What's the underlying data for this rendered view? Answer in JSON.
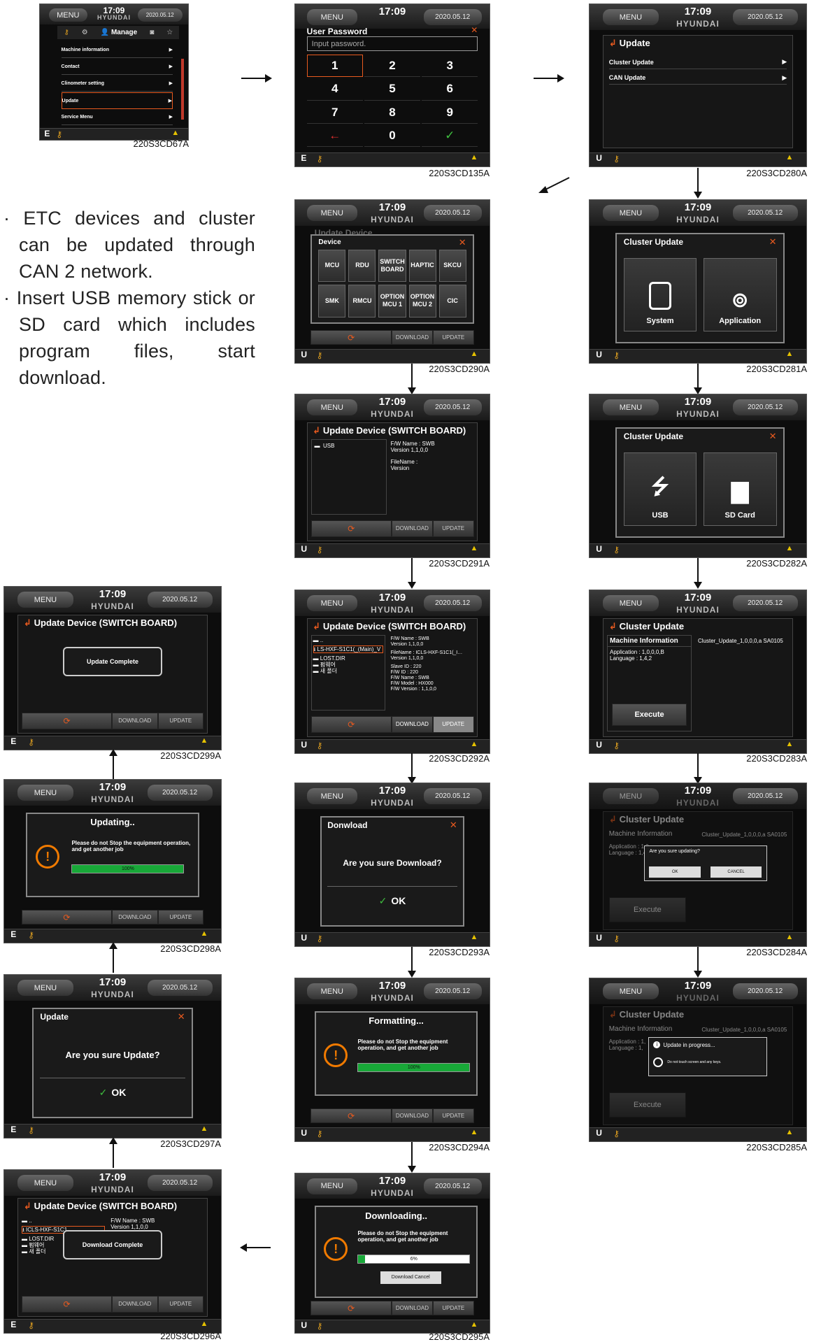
{
  "header": {
    "time": "17:09",
    "brand": "HYUNDAI",
    "menu": "MENU",
    "date": "2020.05.12"
  },
  "bullets": [
    "· ETC devices and cluster can be updated through CAN 2 network.",
    "· Insert USB memory stick or SD card which includes program files, start download."
  ],
  "captions": {
    "c67": "220S3CD67A",
    "c135": "220S3CD135A",
    "c280": "220S3CD280A",
    "c290": "220S3CD290A",
    "c281": "220S3CD281A",
    "c291": "220S3CD291A",
    "c282": "220S3CD282A",
    "c299": "220S3CD299A",
    "c292": "220S3CD292A",
    "c283": "220S3CD283A",
    "c298": "220S3CD298A",
    "c293": "220S3CD293A",
    "c284": "220S3CD284A",
    "c297": "220S3CD297A",
    "c294": "220S3CD294A",
    "c285": "220S3CD285A",
    "c296": "220S3CD296A",
    "c295": "220S3CD295A"
  },
  "s67": {
    "tab": "Manage",
    "items": [
      "Machine information",
      "Contact",
      "Clinometer setting",
      "Update",
      "Service Menu"
    ],
    "mode": "E"
  },
  "s135": {
    "title": "User Password",
    "placeholder": "Input password.",
    "keys": [
      "1",
      "2",
      "3",
      "4",
      "5",
      "6",
      "7",
      "8",
      "9",
      "←",
      "0",
      "✓"
    ],
    "mode": "E"
  },
  "s280": {
    "title": "Update",
    "items": [
      "Cluster Update",
      "CAN Update"
    ],
    "mode": "U"
  },
  "s290": {
    "under": "Update Device",
    "title": "Device",
    "devices": [
      "MCU",
      "RDU",
      "SWITCH BOARD",
      "HAPTIC",
      "SKCU",
      "SMK",
      "RMCU",
      "OPTION MCU 1",
      "OPTION MCU 2",
      "CIC"
    ],
    "download": "DOWNLOAD",
    "update": "UPDATE",
    "mode": "U"
  },
  "s281": {
    "title": "Cluster Update",
    "btn1": "System",
    "btn2": "Application",
    "mode": "U"
  },
  "s291": {
    "title": "Update Device (SWITCH BOARD)",
    "usb": "USB",
    "info": "F/W Name : SWB",
    "version": "Version 1,1,0,0",
    "file": "FileName :",
    "filever": "Version",
    "download": "DOWNLOAD",
    "update": "UPDATE",
    "mode": "U"
  },
  "s282": {
    "title": "Cluster Update",
    "btn1": "USB",
    "btn2": "SD Card",
    "mode": "U"
  },
  "s292": {
    "title": "Update Device (SWITCH BOARD)",
    "files": [
      "..",
      "LS-HXF-S1C1(_(Main)_V",
      "LOST.DIR",
      "펌웨어",
      "새 폴더"
    ],
    "info": "F/W Name : SWB",
    "version": "Version 1,1,0,0",
    "file": "FileName : ICLS-HXF-S1C1(_I…",
    "details": [
      "Slave ID : 220",
      "F/W ID : 220",
      "F/W Name : SWB",
      "F/W Model : HX000",
      "F/W Version : 1,1,0,0"
    ],
    "download": "DOWNLOAD",
    "update": "UPDATE",
    "mode": "U"
  },
  "s283": {
    "title": "Cluster Update",
    "machine": "Machine Information",
    "app": "Application : 1,0,0,0,B",
    "lang": "Language : 1,4,2",
    "file": "Cluster_Update_1,0,0,0,a SA0105",
    "execute": "Execute",
    "mode": "U"
  },
  "s299": {
    "title": "Update Device (SWITCH BOARD)",
    "msg": "Update Complete",
    "download": "DOWNLOAD",
    "update": "UPDATE",
    "mode": "E"
  },
  "s298": {
    "title": "Updating..",
    "msg": "Please do not Stop the equipment operation, and get another job",
    "pct": "100%",
    "download": "DOWNLOAD",
    "update": "UPDATE",
    "mode": "E",
    "progress": 1.0
  },
  "s293": {
    "title": "Donwload",
    "question": "Are you sure Download?",
    "ok": "OK",
    "mode": "U"
  },
  "s284": {
    "title": "Cluster Update",
    "machine": "Machine Information",
    "question": "Are you sure updating?",
    "ok": "OK",
    "cancel": "CANCEL",
    "app": "Application : 1,0",
    "lang": "Language : 1,4",
    "file": "Cluster_Update_1,0,0,0,a SA0105",
    "execute": "Execute",
    "mode": "U"
  },
  "s297": {
    "title": "Update",
    "question": "Are you sure Update?",
    "ok": "OK",
    "mode": "E"
  },
  "s294": {
    "title": "Formatting...",
    "msg": "Please do not Stop the equipment operation, and get another job",
    "pct": "100%",
    "download": "DOWNLOAD",
    "update": "UPDATE",
    "mode": "U",
    "progress": 1.0
  },
  "s285": {
    "title": "Cluster Update",
    "machine": "Machine Information",
    "msg": "Update in progress...",
    "sub": "Do not touch screen and any keys.",
    "app": "Application : 1,",
    "lang": "Language : 1,",
    "file": "Cluster_Update_1,0,0,0,a SA0105",
    "execute": "Execute",
    "mode": "U"
  },
  "s296": {
    "title": "Update Device (SWITCH BOARD)",
    "msg": "Download Complete",
    "files": [
      "..",
      "ICLS-HXF-S1C1",
      "LOST.DIR",
      "펌웨어",
      "새 폴더"
    ],
    "info": "F/W Name : SWB",
    "version": "Version 1,1,0,0",
    "download": "DOWNLOAD",
    "update": "UPDATE",
    "mode": "E"
  },
  "s295": {
    "title": "Downloading..",
    "msg": "Please do not Stop the equipment operation, and get another job",
    "pct": "6%",
    "cancel": "Download Cancel",
    "download": "DOWNLOAD",
    "update": "UPDATE",
    "mode": "U",
    "progress": 0.06
  },
  "colors": {
    "accent": "#e85a1f",
    "ok": "#3fbf3f",
    "progress": "#18a838",
    "warn": "#f07a00"
  }
}
